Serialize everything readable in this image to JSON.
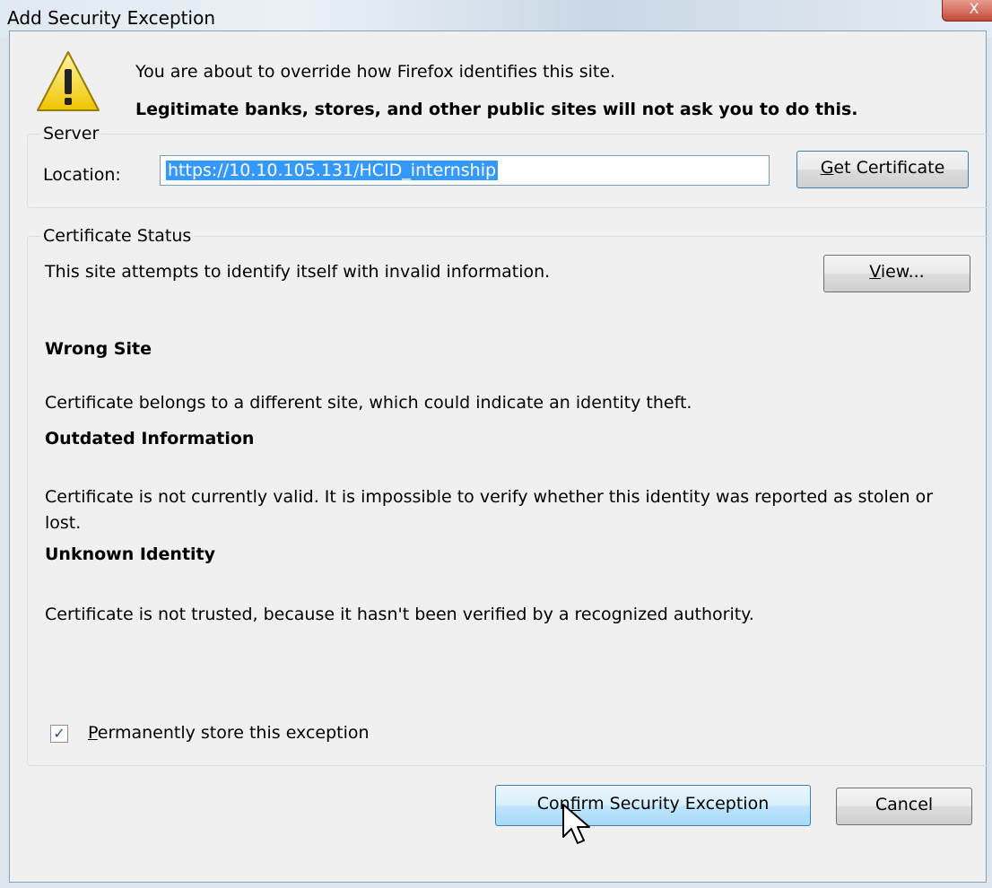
{
  "window": {
    "title": "Add Security Exception",
    "close_label": "X"
  },
  "warning": {
    "line1": "You are about to override how Firefox identifies this site.",
    "line2": "Legitimate banks, stores, and other public sites will not ask you to do this.",
    "icon": "warning-triangle-icon"
  },
  "server": {
    "legend": "Server",
    "location_label": "Location:",
    "location_value": "https://10.10.105.131/HCID_internship",
    "get_certificate_prefix": "",
    "get_certificate_mnemonic": "G",
    "get_certificate_rest": "et Certificate"
  },
  "status": {
    "legend": "Certificate Status",
    "intro": "This site attempts to identify itself with invalid information.",
    "view_mnemonic": "V",
    "view_rest": "iew...",
    "issues": [
      {
        "title": "Wrong Site",
        "text": "Certificate belongs to a different site, which could indicate an identity theft."
      },
      {
        "title": "Outdated Information",
        "text": "Certificate is not currently valid. It is impossible to verify whether this identity was reported as stolen or lost."
      },
      {
        "title": "Unknown Identity",
        "text": "Certificate is not trusted, because it hasn't been verified by a recognized authority."
      }
    ],
    "permanent_checked": true,
    "permanent_mnemonic": "P",
    "permanent_rest": "ermanently store this exception"
  },
  "actions": {
    "confirm_prefix": "Con",
    "confirm_mnemonic": "f",
    "confirm_rest": "irm Security Exception",
    "cancel_label": "Cancel"
  }
}
